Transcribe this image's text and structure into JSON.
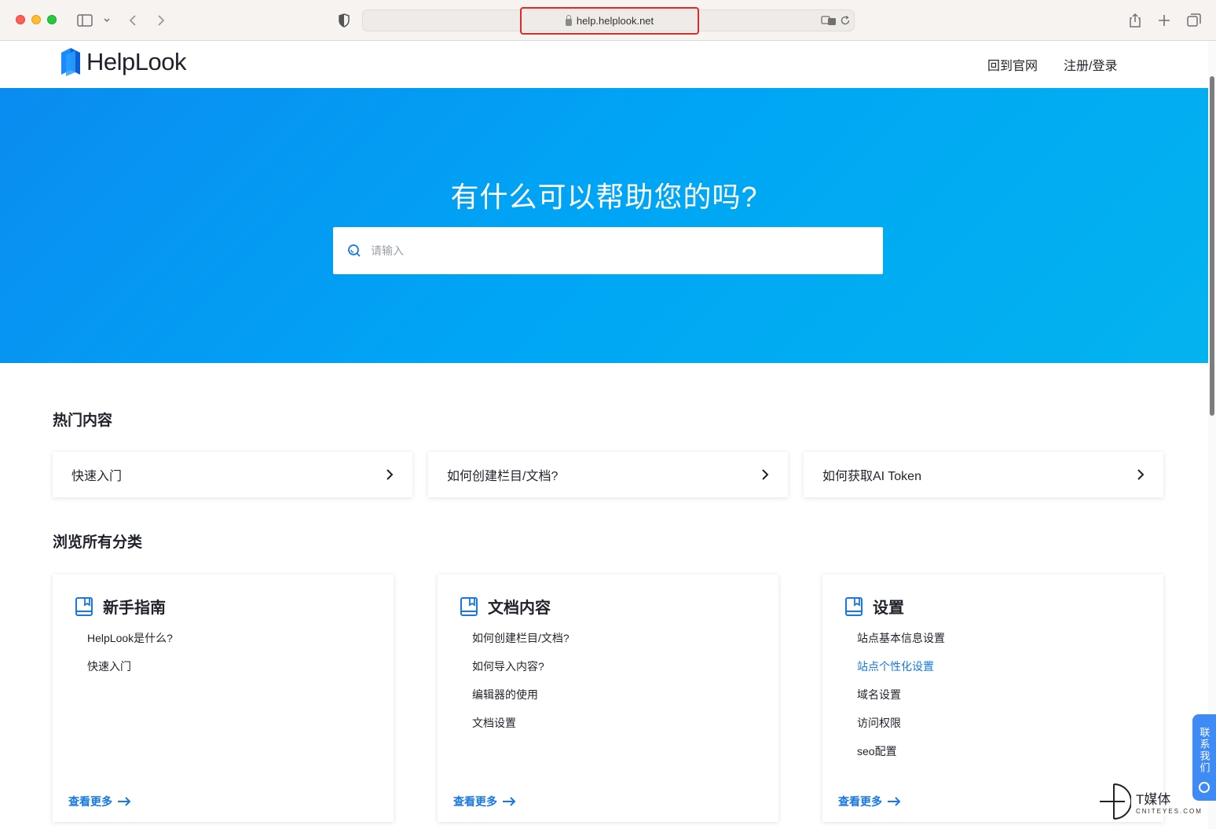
{
  "browser": {
    "url": "help.helplook.net"
  },
  "header": {
    "logo_text": "HelpLook",
    "nav": [
      "回到官网",
      "注册/登录"
    ]
  },
  "hero": {
    "title": "有什么可以帮助您的吗?",
    "search_placeholder": "请输入"
  },
  "hot": {
    "title": "热门内容",
    "items": [
      "快速入门",
      "如何创建栏目/文档?",
      "如何获取AI Token"
    ]
  },
  "categories": {
    "title": "浏览所有分类",
    "more_label": "查看更多",
    "cards": [
      {
        "title": "新手指南",
        "items": [
          "HelpLook是什么?",
          "快速入门"
        ]
      },
      {
        "title": "文档内容",
        "items": [
          "如何创建栏目/文档?",
          "如何导入内容?",
          "编辑器的使用",
          "文档设置"
        ]
      },
      {
        "title": "设置",
        "items": [
          "站点基本信息设置",
          "站点个性化设置",
          "域名设置",
          "访问权限",
          "seo配置"
        ],
        "active_index": 1
      }
    ]
  },
  "contact": {
    "label": "联系我们"
  },
  "watermark": {
    "big": "T媒体",
    "small": "CNITEYES.COM"
  },
  "colors": {
    "brand": "#1677e5",
    "hero_start": "#0a8cf0",
    "hero_end": "#03b3ee"
  }
}
